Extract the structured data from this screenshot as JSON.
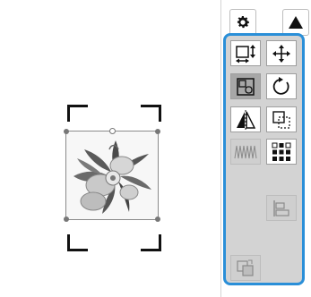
{
  "toolbar": {
    "settings_icon": "gear-icon",
    "collapse_icon": "triangle-up-icon"
  },
  "edit_panel": {
    "buttons": [
      {
        "name": "size-button",
        "icon": "resize-icon",
        "state": "normal"
      },
      {
        "name": "move-button",
        "icon": "move-arrows-icon",
        "state": "normal"
      },
      {
        "name": "group-button",
        "icon": "group-icon",
        "state": "selected"
      },
      {
        "name": "rotate-button",
        "icon": "rotate-icon",
        "state": "normal"
      },
      {
        "name": "mirror-button",
        "icon": "flip-horizontal-icon",
        "state": "normal"
      },
      {
        "name": "duplicate-button",
        "icon": "duplicate-icon",
        "state": "normal"
      },
      {
        "name": "density-button",
        "icon": "density-icon",
        "state": "disabled"
      },
      {
        "name": "color-sort-button",
        "icon": "color-grid-icon",
        "state": "normal"
      },
      {
        "name": "align-button",
        "icon": "align-bottom-icon",
        "state": "disabled"
      },
      {
        "name": "arrange-button",
        "icon": "arrange-layers-icon",
        "state": "disabled"
      }
    ]
  },
  "colors": {
    "accent": "#2a8fd8",
    "panel_bg": "#d3d3d3",
    "selected_bg": "#a7a7a7"
  }
}
